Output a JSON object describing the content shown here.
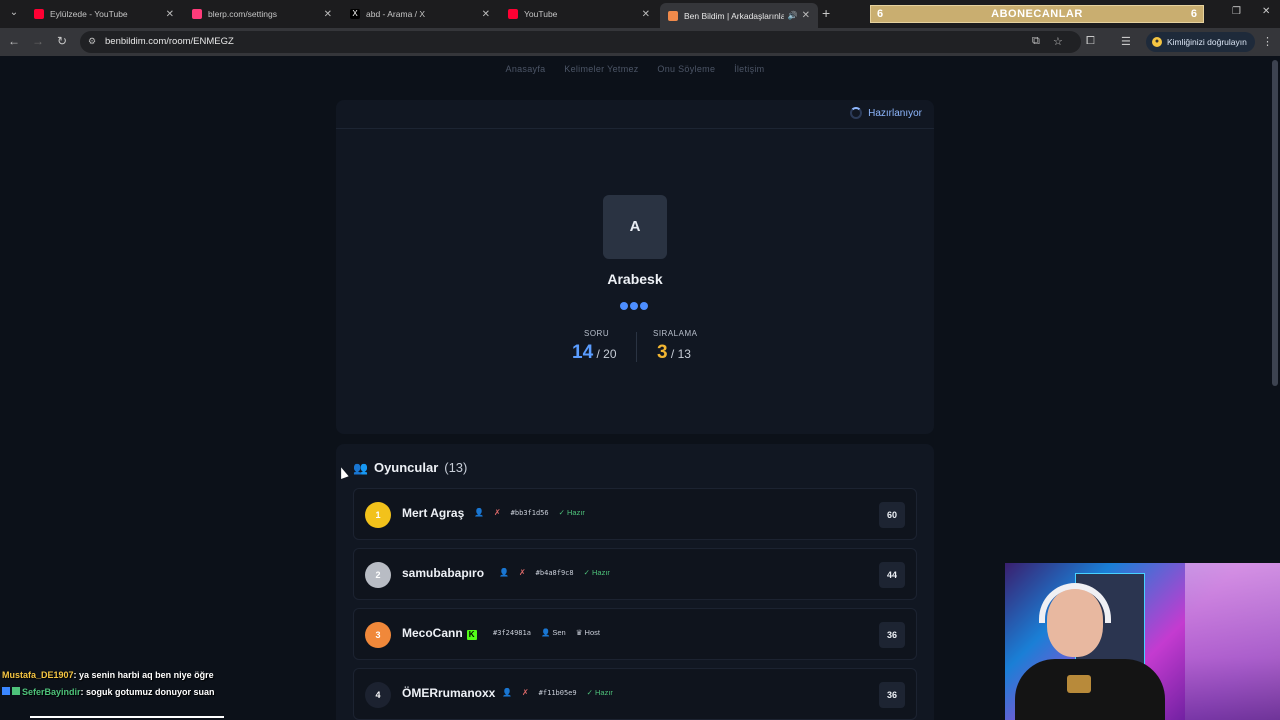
{
  "browser": {
    "tabs": [
      {
        "title": "Eylülzede - YouTube",
        "favicon_color": "#ff0033"
      },
      {
        "title": "blerp.com/settings",
        "favicon_color": "#ff3b7a"
      },
      {
        "title": "abd - Arama / X",
        "favicon_color": "#000000"
      },
      {
        "title": "YouTube",
        "favicon_color": "#ff0033"
      },
      {
        "title": "Ben Bildim | Arkadaşlarınla",
        "favicon_color": "#f08a4b"
      }
    ],
    "subscriber_banner": {
      "left_count": "6",
      "label": "ABONECANLAR",
      "right_count": "6"
    },
    "url": "benbildim.com/room/ENMEGZ",
    "verify_label": "Kimliğinizi doğrulayın"
  },
  "site_nav": [
    "Anasayfa",
    "Kelimeler Yetmez",
    "Onu Söyleme",
    "İletişim"
  ],
  "game": {
    "status": "Hazırlanıyor",
    "letter": "A",
    "category": "Arabesk",
    "question_label": "SORU",
    "question_current": "14",
    "question_total": "/ 20",
    "rank_label": "SIRALAMA",
    "rank_current": "3",
    "rank_total": "/ 13"
  },
  "players": {
    "title": "Oyuncular",
    "count": "(13)",
    "list": [
      {
        "rank": "1",
        "name": "Mert Agraş",
        "hash": "#bb3f1d56",
        "tag": "Hazır",
        "score": "60",
        "rank_color": "#f2c21b"
      },
      {
        "rank": "2",
        "name": "samubabapıro",
        "hash": "#b4a8f9c8",
        "tag": "Hazır",
        "score": "44",
        "rank_color": "#b8bcc4"
      },
      {
        "rank": "3",
        "name": "MecoCann",
        "hash": "#3f24981a",
        "tag_you": "Sen",
        "tag_host": "Host",
        "score": "36",
        "rank_color": "#f0883a"
      },
      {
        "rank": "4",
        "name": "ÖMERrumanoxx",
        "hash": "#f11b05e9",
        "tag": "Hazır",
        "score": "36",
        "rank_color": "#1c2230"
      }
    ]
  },
  "chat": [
    {
      "user": "Mustafa_DE1907",
      "text": ": ya senin harbi aq ben niye öğre"
    },
    {
      "user": "SeferBayindir",
      "text": ": soguk gotumuz donuyor suan"
    }
  ]
}
